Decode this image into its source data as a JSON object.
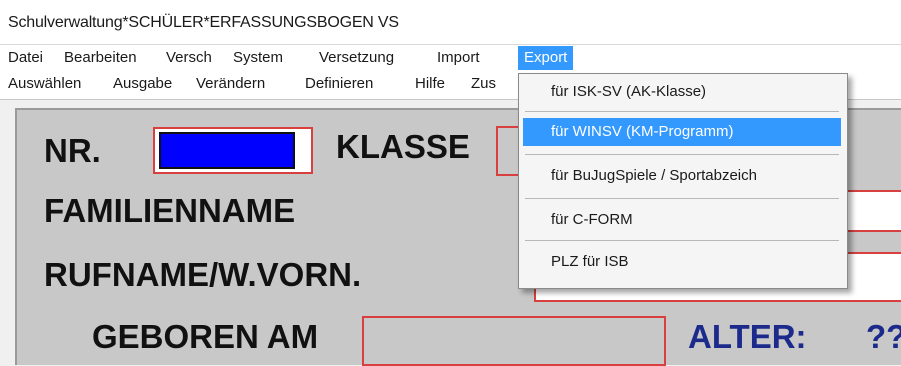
{
  "window": {
    "title": "Schulverwaltung*SCHÜLER*ERFASSUNGSBOGEN VS"
  },
  "menubar": {
    "row1": [
      "Datei",
      "Bearbeiten",
      "Versch",
      "System",
      "Versetzung",
      "Import",
      "Export"
    ],
    "row2": [
      "Auswählen",
      "Ausgabe",
      "Verändern",
      "Definieren",
      "Hilfe",
      "Zus"
    ],
    "active": "Export"
  },
  "export_menu": {
    "items": [
      "für ISK-SV (AK-Klasse)",
      "für WINSV (KM-Programm)",
      "für BuJugSpiele / Sportabzeich",
      "für C-FORM",
      "PLZ für ISB"
    ],
    "highlighted_index": 1
  },
  "form": {
    "nr_label": "NR.",
    "klasse_label": "KLASSE",
    "familienname_label": "FAMILIENNAME",
    "rufname_label": "RUFNAME/W.VORN.",
    "geboren_label": "GEBOREN AM",
    "alter_label": "ALTER:",
    "alter_value": "??"
  },
  "colors": {
    "highlight": "#3399ff",
    "field_border": "#d84040",
    "nr_fill": "#0000ff",
    "alter_text": "#1c2a8c"
  }
}
